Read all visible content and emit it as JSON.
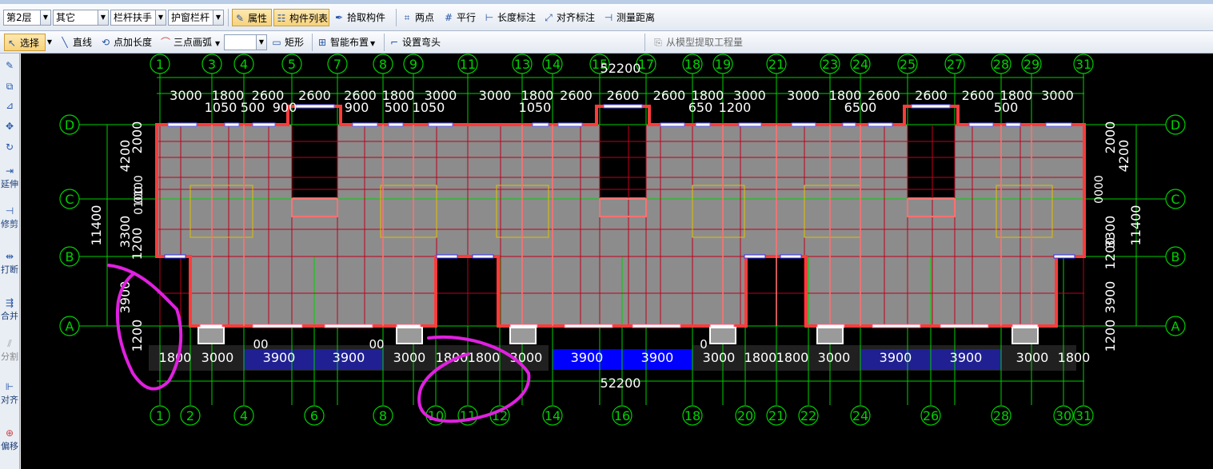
{
  "toolbar1": {
    "floor": "第2层",
    "category": "其它",
    "component_type": "栏杆扶手",
    "component_name": "护窗栏杆",
    "property_label": "属性",
    "component_list_label": "构件列表",
    "pick_label": "拾取构件",
    "two_point_label": "两点",
    "parallel_label": "平行",
    "length_dim_label": "长度标注",
    "align_dim_label": "对齐标注",
    "measure_label": "测量距离"
  },
  "toolbar2": {
    "select_label": "选择",
    "line_label": "直线",
    "point_len_label": "点加长度",
    "arc_label": "三点画弧",
    "rect_label": "矩形",
    "smart_label": "智能布置",
    "bend_label": "设置弯头",
    "extract_label": "从模型提取工程量"
  },
  "sidebar": {
    "extend": "延伸",
    "trim": "修剪",
    "break": "打断",
    "merge": "合并",
    "split": "分割",
    "align": "对齐",
    "offset": "偏移"
  },
  "colors": {
    "grid": "#00d000",
    "wall": "#ff3b3b",
    "slab": "#8c8c8c",
    "beam": "#c0001c",
    "balcony": "#0000ff",
    "annotation": "#e020e0",
    "dim_text": "#ffffff"
  },
  "drawing": {
    "top_axes": [
      "1",
      "3",
      "4",
      "5",
      "7",
      "8",
      "9",
      "11",
      "13",
      "14",
      "15",
      "17",
      "18",
      "19",
      "21",
      "23",
      "24",
      "25",
      "27",
      "28",
      "29",
      "31"
    ],
    "bottom_axes": [
      "1",
      "2",
      "4",
      "6",
      "8",
      "10",
      "11",
      "12",
      "14",
      "16",
      "18",
      "20",
      "21",
      "22",
      "24",
      "26",
      "28",
      "30",
      "31"
    ],
    "row_axes": [
      "D",
      "C",
      "B",
      "A"
    ],
    "total_length": "52200",
    "total_depth": "11400",
    "top_dims_1": [
      "3000",
      "1800",
      "2600",
      "2600",
      "2600",
      "1800",
      "3000",
      "3000",
      "1800",
      "2600",
      "2600",
      "2600",
      "1800",
      "3000",
      "3000",
      "1800",
      "2600",
      "2600",
      "2600",
      "1800",
      "3000"
    ],
    "top_dims_2": [
      "1050",
      "500",
      "900",
      "900",
      "500",
      "1050",
      "1050",
      "650",
      "1200",
      "6500",
      "500"
    ],
    "bottom_dims": [
      "1800",
      "3000",
      "3900",
      "3900",
      "3000",
      "1800",
      "1800",
      "3000",
      "3900",
      "3900",
      "3000",
      "1800",
      "1800",
      "3000",
      "3900",
      "3900",
      "3000",
      "1800"
    ],
    "left_dims": [
      "4200",
      "2000",
      "3300",
      "1200",
      "3900",
      "1200"
    ],
    "left_small": [
      "0100",
      "0100"
    ],
    "right_dims": [
      "2000",
      "4200",
      "3300",
      "1200",
      "3900",
      "1200"
    ],
    "right_small": [
      "0000"
    ],
    "stray_labels": [
      "0",
      "00",
      "00"
    ]
  }
}
